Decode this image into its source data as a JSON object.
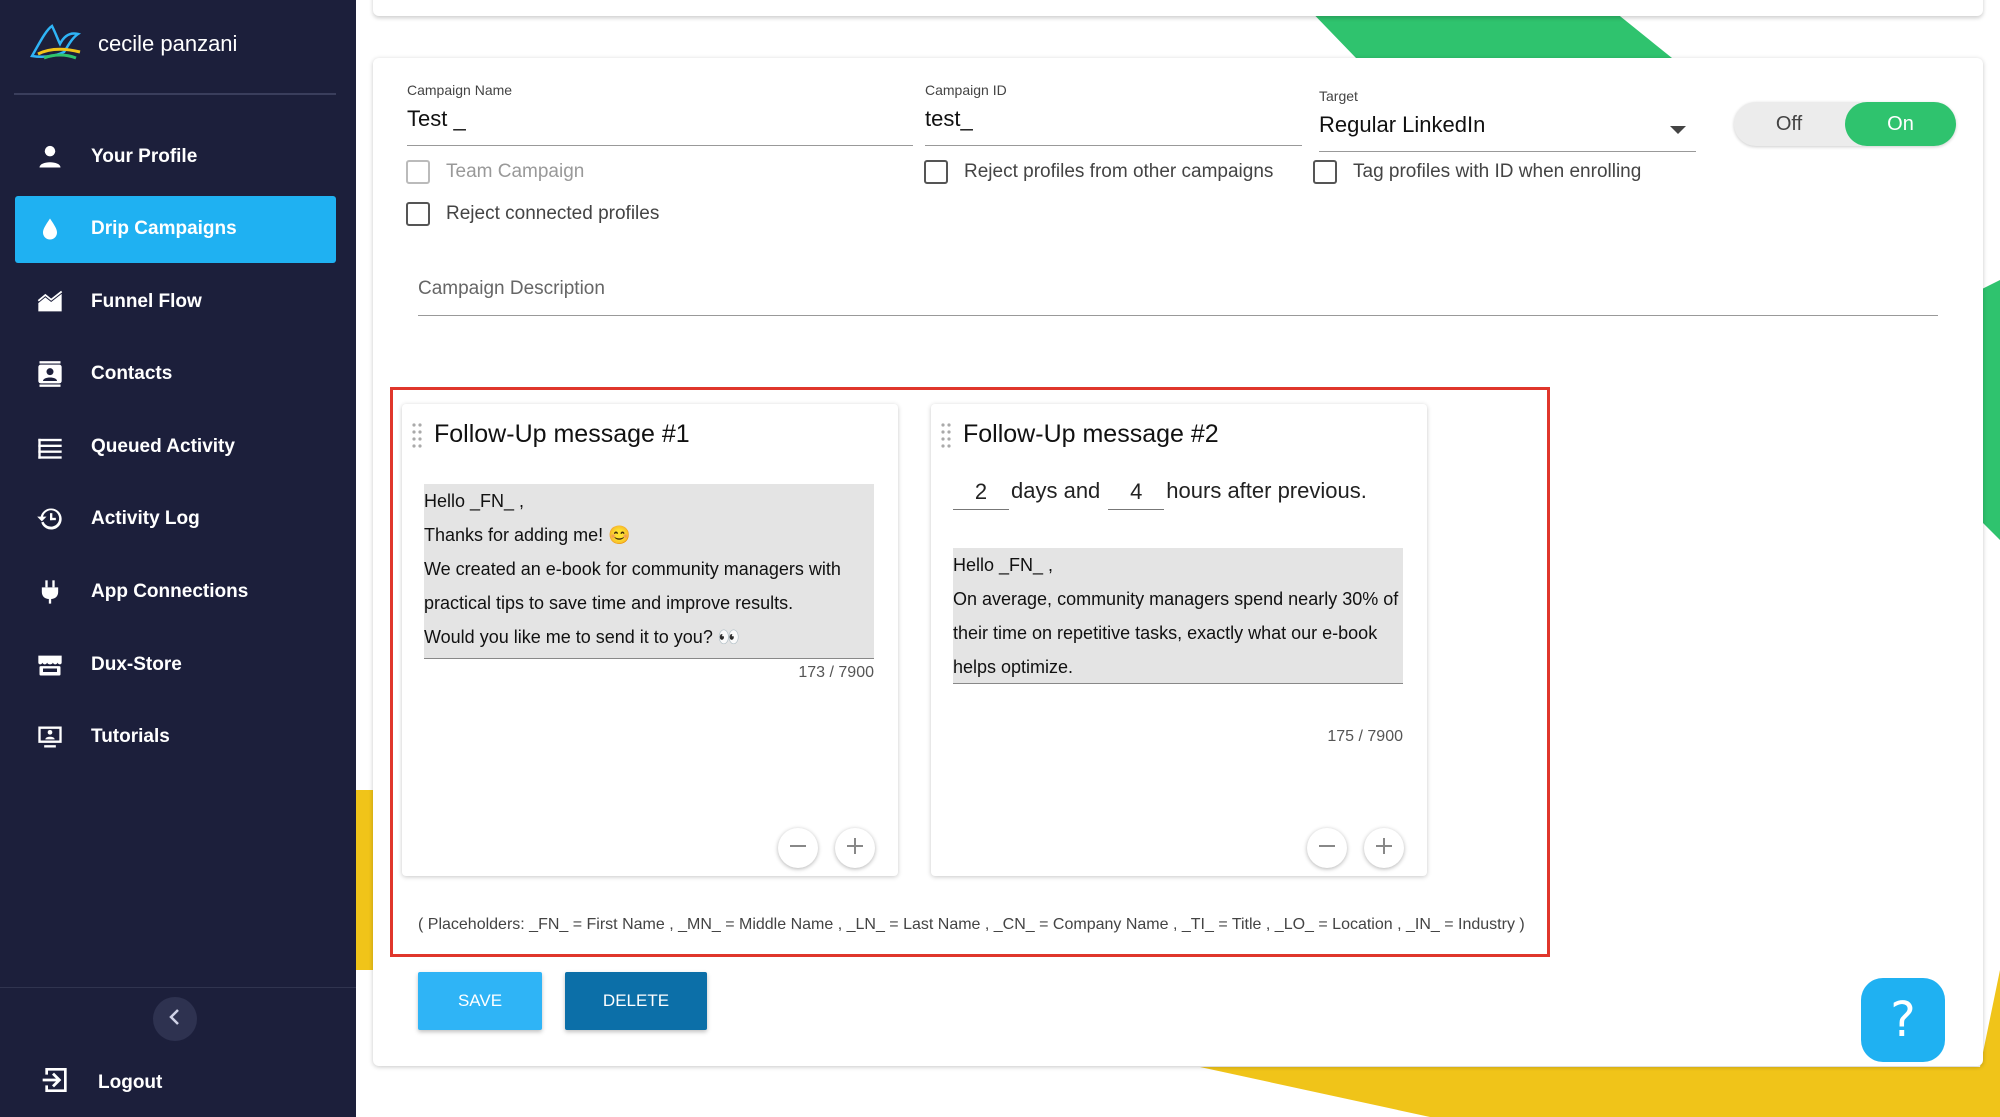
{
  "brand": {
    "name": "cecile panzani",
    "logo_icon": "bird-logo-icon"
  },
  "sidebar": {
    "items": [
      {
        "label": "Your Profile",
        "icon": "person-icon",
        "active": false
      },
      {
        "label": "Drip Campaigns",
        "icon": "drop-icon",
        "active": true
      },
      {
        "label": "Funnel Flow",
        "icon": "area-chart-icon",
        "active": false
      },
      {
        "label": "Contacts",
        "icon": "contacts-icon",
        "active": false
      },
      {
        "label": "Queued Activity",
        "icon": "queue-icon",
        "active": false
      },
      {
        "label": "Activity Log",
        "icon": "history-icon",
        "active": false
      },
      {
        "label": "App Connections",
        "icon": "plug-icon",
        "active": false
      },
      {
        "label": "Dux-Store",
        "icon": "store-icon",
        "active": false
      },
      {
        "label": "Tutorials",
        "icon": "monitor-icon",
        "active": false
      }
    ],
    "logout_label": "Logout"
  },
  "campaign": {
    "name_label": "Campaign Name",
    "name_value": "Test _",
    "id_label": "Campaign ID",
    "id_value": "test_",
    "target_label": "Target",
    "target_value": "Regular LinkedIn",
    "toggle_off": "Off",
    "toggle_on": "On",
    "toggle_state": "On",
    "team_campaign": "Team Campaign",
    "reject_other": "Reject profiles from other campaigns",
    "tag_profiles": "Tag profiles with ID when enrolling",
    "reject_connected": "Reject connected profiles",
    "description_placeholder": "Campaign Description"
  },
  "messages": [
    {
      "title": "Follow-Up message #1",
      "text": "Hello _FN_ ,\nThanks for adding me! 😊\nWe created an e-book for community managers with practical tips to save time and improve results.\nWould you like me to send it to you? 👀",
      "count": "173 / 7900"
    },
    {
      "title": "Follow-Up message #2",
      "delay_days": "2",
      "days_text": "days and",
      "delay_hours": "4",
      "hours_text": "hours after previous.",
      "text": "Hello _FN_ ,\nOn average, community managers spend nearly 30% of their time on repetitive tasks, exactly what our e-book helps optimize.",
      "count": "175 / 7900"
    }
  ],
  "placeholders_text": "( Placeholders: _FN_ = First Name , _MN_ = Middle Name , _LN_ = Last Name , _CN_ = Company Name , _TI_ = Title , _LO_ = Location , _IN_ = Industry )",
  "actions": {
    "save": "SAVE",
    "delete": "DELETE"
  },
  "help": {
    "label": "?"
  },
  "colors": {
    "sidebar_bg": "#1c1f3b",
    "active_nav": "#1fb1f2",
    "toggle_on": "#2fc36e",
    "save_button": "#2fb4f6",
    "delete_button": "#0c6fa8",
    "highlight_border": "#e0362b",
    "deco_green": "#2fc36e",
    "deco_yellow": "#f0c419"
  }
}
